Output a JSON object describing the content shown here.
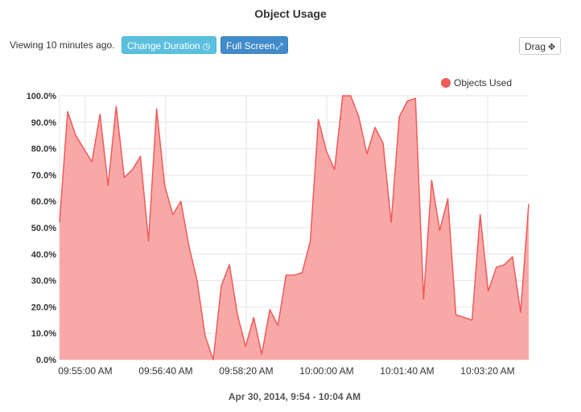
{
  "page": {
    "title": "Object Usage",
    "viewing_text": "Viewing 10 minutes ago.",
    "footer": "Apr 30, 2014, 9:54 - 10:04 AM"
  },
  "toolbar": {
    "change_duration_label": "Change Duration",
    "change_duration_icon": "clock-icon",
    "full_screen_label": "Full Screen",
    "full_screen_icon": "expand-icon",
    "drag_label": "Drag",
    "drag_icon": "move-icon"
  },
  "colors": {
    "series_line": "#f05a5a",
    "series_fill": "#f8a9a7",
    "btn_info": "#5bc0de",
    "btn_primary": "#428bca"
  },
  "chart_data": {
    "type": "area",
    "ylim": [
      0,
      100
    ],
    "y_ticks": [
      0,
      10,
      20,
      30,
      40,
      50,
      60,
      70,
      80,
      90,
      100
    ],
    "y_tick_labels": [
      "0.0%",
      "10.0%",
      "20.0%",
      "30.0%",
      "40.0%",
      "50.0%",
      "60.0%",
      "70.0%",
      "80.0%",
      "90.0%",
      "100.0%"
    ],
    "x_tick_labels": [
      "09:55:00 AM",
      "09:56:40 AM",
      "09:58:20 AM",
      "10:00:00 AM",
      "10:01:40 AM",
      "10:03:20 AM"
    ],
    "legend_position": "top-right",
    "grid": true,
    "series": [
      {
        "name": "Objects Used",
        "values": [
          52,
          94,
          85,
          80,
          75,
          93,
          66,
          96,
          69,
          72,
          77,
          45,
          95,
          66,
          55,
          60,
          43,
          30,
          9,
          0,
          28,
          36,
          17,
          5,
          16,
          2,
          19,
          13,
          32,
          32,
          33,
          45,
          91,
          79,
          72,
          100,
          100,
          92,
          78,
          88,
          82,
          52,
          92,
          98,
          99,
          23,
          68,
          49,
          61,
          17,
          16,
          15,
          55,
          26,
          35,
          36,
          39,
          18,
          59
        ]
      }
    ]
  }
}
